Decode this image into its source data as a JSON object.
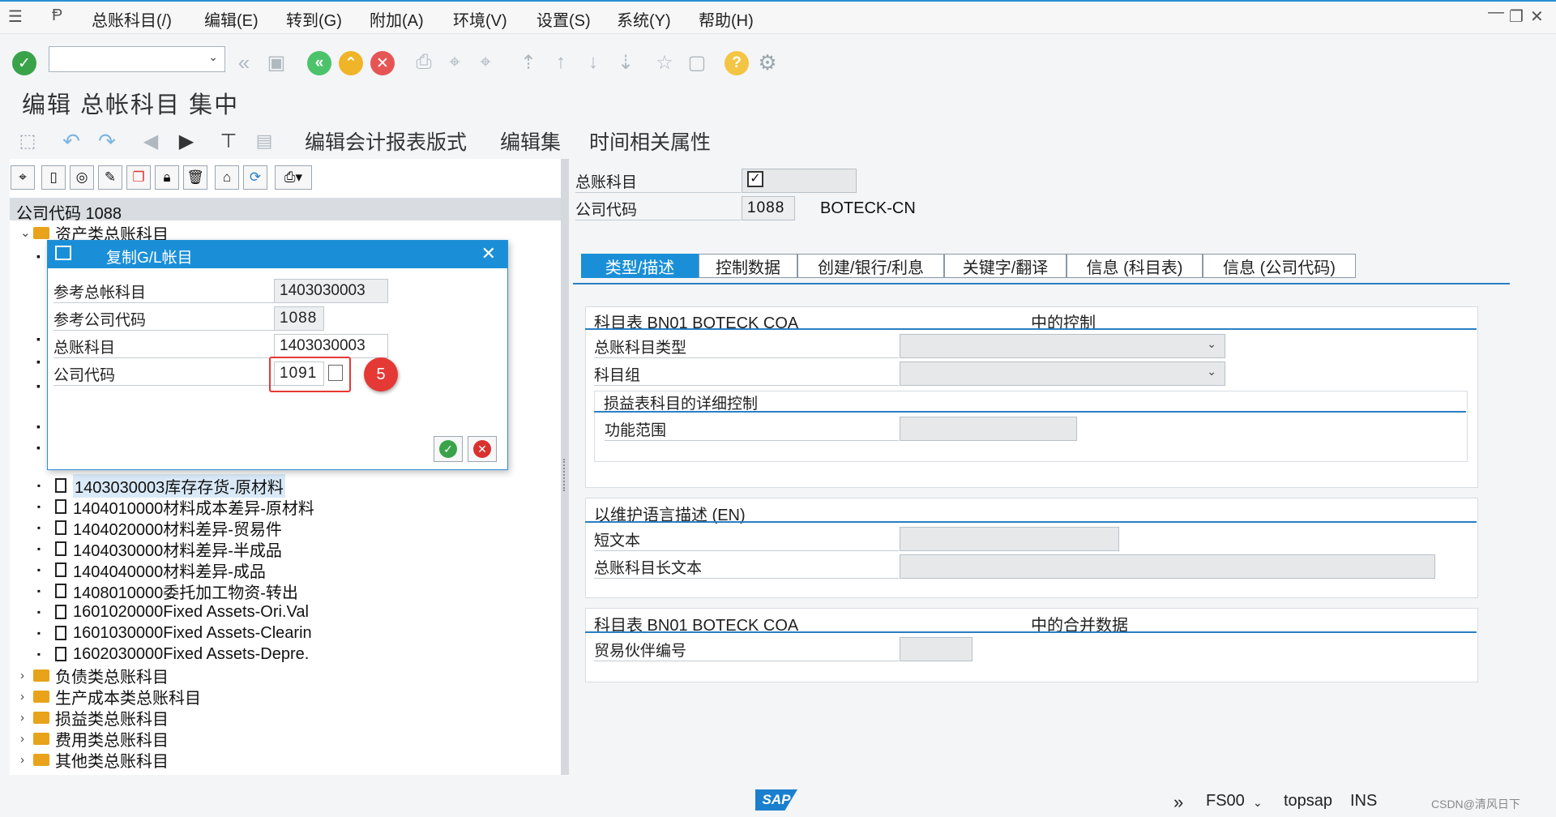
{
  "menu": {
    "items": [
      "总账科目(/)",
      "编辑(E)",
      "转到(G)",
      "附加(A)",
      "环境(V)",
      "设置(S)",
      "系统(Y)",
      "帮助(H)"
    ]
  },
  "page_title": "编辑 总帐科目 集中",
  "app_toolbar": {
    "layout": "编辑会计报表版式",
    "edit_set": "编辑集",
    "time_attr": "时间相关属性"
  },
  "tree": {
    "company_header": "公司代码 1088",
    "root_folder": "资产类总账科目",
    "items": [
      "1403030003库存存货-原材料",
      "1404010000材料成本差异-原材料",
      "1404020000材料差异-贸易件",
      "1404030000材料差异-半成品",
      "1404040000材料差异-成品",
      "1408010000委托加工物资-转出",
      "1601020000Fixed Assets-Ori.Val",
      "1601030000Fixed Assets-Clearin",
      "1602030000Fixed Assets-Depre."
    ],
    "folders": [
      "负债类总账科目",
      "生产成本类总账科目",
      "损益类总账科目",
      "费用类总账科目",
      "其他类总账科目"
    ]
  },
  "dialog": {
    "title": "复制G/L帐目",
    "ref_account_label": "参考总帐科目",
    "ref_account_value": "1403030003",
    "ref_company_label": "参考公司代码",
    "ref_company_value": "1088",
    "account_label": "总账科目",
    "account_value": "1403030003",
    "company_label": "公司代码",
    "company_value": "1091",
    "callout": "5"
  },
  "header_fields": {
    "account_label": "总账科目",
    "company_label": "公司代码",
    "company_value": "1088",
    "company_name": "BOTECK-CN"
  },
  "tabs": [
    "类型/描述",
    "控制数据",
    "创建/银行/利息",
    "关键字/翻译",
    "信息 (科目表)",
    "信息 (公司代码)"
  ],
  "group_control": {
    "title_left": "科目表 BN01 BOTECK COA",
    "title_right": "中的控制",
    "account_type": "总账科目类型",
    "account_group": "科目组",
    "pl_detail": "损益表科目的详细控制",
    "functional_area": "功能范围"
  },
  "group_desc": {
    "title": "以维护语言描述 (EN)",
    "short_text": "短文本",
    "long_text": "总账科目长文本"
  },
  "group_consol": {
    "title_left": "科目表 BN01 BOTECK COA",
    "title_right": "中的合并数据",
    "trading_partner": "贸易伙伴编号"
  },
  "status": {
    "tcode": "FS00",
    "server": "topsap",
    "mode": "INS",
    "watermark": "CSDN@清风日下"
  },
  "colors": {
    "accent": "#1a8fd8",
    "callout": "#e53935",
    "highlight": "#d9e9f7"
  }
}
